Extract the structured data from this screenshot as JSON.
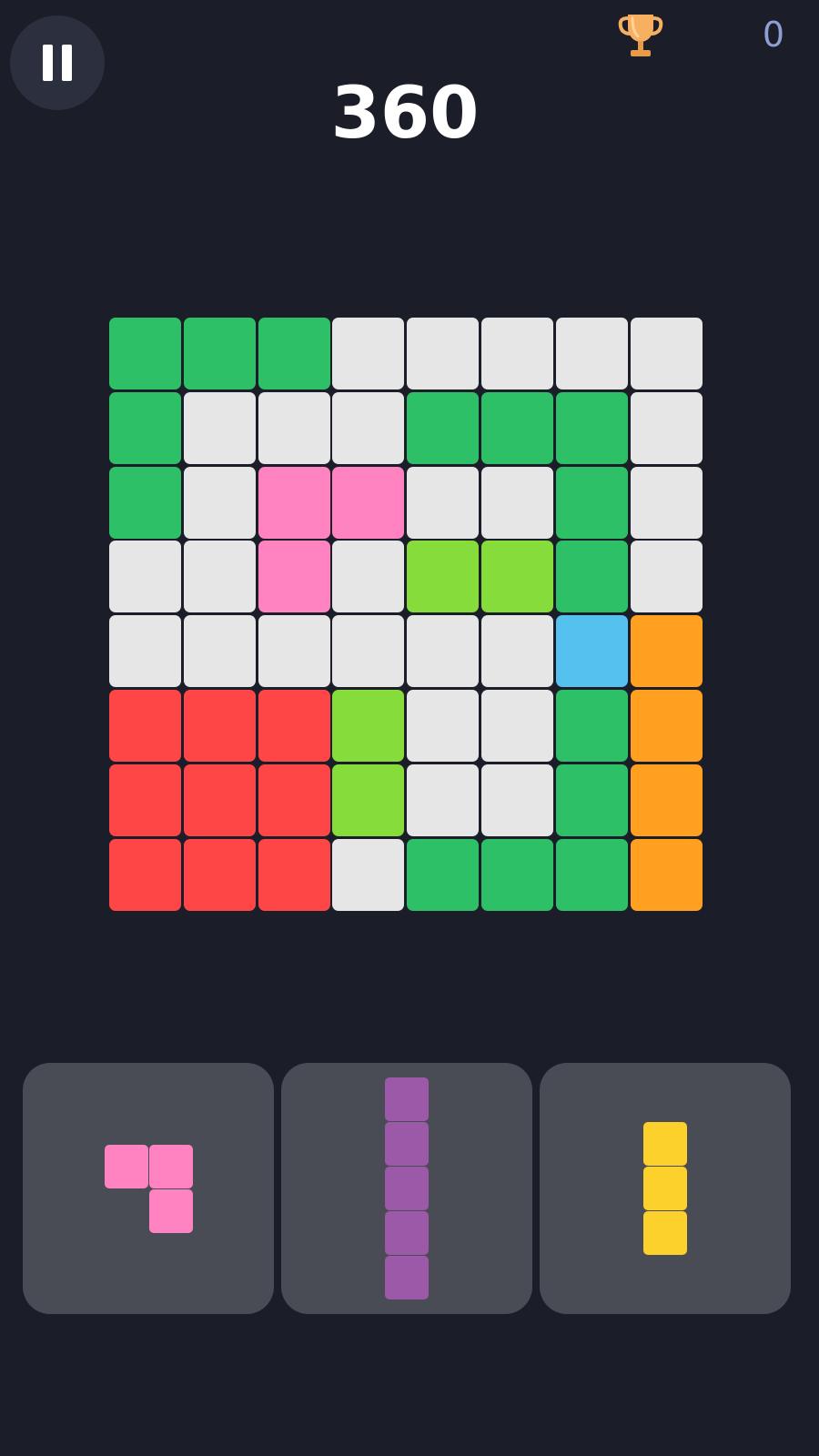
{
  "colors": {
    "background": "#1b1d29",
    "empty": "#e6e6e6",
    "green": "#2ec066",
    "pink": "#ff82c1",
    "lime": "#86dc3a",
    "blue": "#55c1ef",
    "orange": "#ffa020",
    "red": "#ff4646",
    "purple": "#9b59a8",
    "yellow": "#fdd12b",
    "tray": "#494b55"
  },
  "header": {
    "pause_icon": "pause-icon",
    "trophy_icon": "trophy-icon",
    "best_score": "0",
    "score": "360"
  },
  "board": {
    "rows": 8,
    "cols": 8,
    "grid": [
      [
        "green",
        "green",
        "green",
        "empty",
        "empty",
        "empty",
        "empty",
        "empty"
      ],
      [
        "green",
        "empty",
        "empty",
        "empty",
        "green",
        "green",
        "green",
        "empty"
      ],
      [
        "green",
        "empty",
        "pink",
        "pink",
        "empty",
        "empty",
        "green",
        "empty"
      ],
      [
        "empty",
        "empty",
        "pink",
        "empty",
        "lime",
        "lime",
        "green",
        "empty"
      ],
      [
        "empty",
        "empty",
        "empty",
        "empty",
        "empty",
        "empty",
        "blue",
        "orange"
      ],
      [
        "red",
        "red",
        "red",
        "lime",
        "empty",
        "empty",
        "green",
        "orange"
      ],
      [
        "red",
        "red",
        "red",
        "lime",
        "empty",
        "empty",
        "green",
        "orange"
      ],
      [
        "red",
        "red",
        "red",
        "empty",
        "green",
        "green",
        "green",
        "orange"
      ]
    ]
  },
  "pieces": [
    {
      "name": "pink-l-piece",
      "color": "pink",
      "cells": [
        [
          0,
          0
        ],
        [
          0,
          1
        ],
        [
          1,
          1
        ]
      ]
    },
    {
      "name": "purple-line-piece",
      "color": "purple",
      "cells": [
        [
          0,
          0
        ],
        [
          1,
          0
        ],
        [
          2,
          0
        ],
        [
          3,
          0
        ],
        [
          4,
          0
        ]
      ]
    },
    {
      "name": "yellow-line-piece",
      "color": "yellow",
      "cells": [
        [
          0,
          0
        ],
        [
          1,
          0
        ],
        [
          2,
          0
        ]
      ]
    }
  ]
}
